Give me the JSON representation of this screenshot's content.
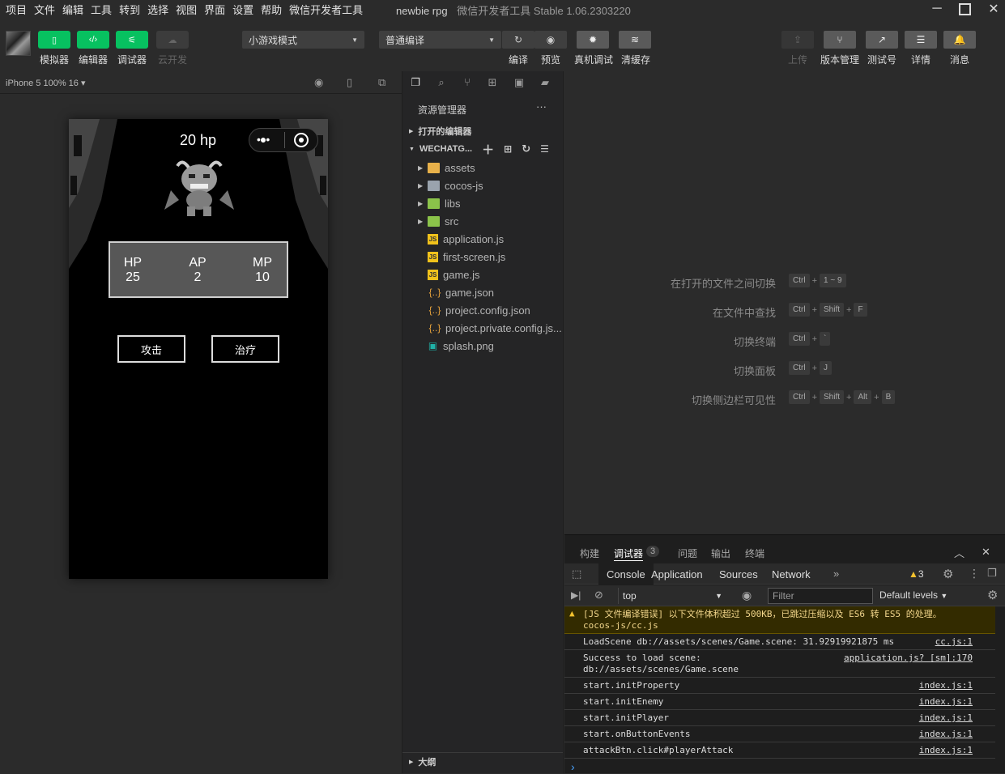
{
  "menu": [
    "项目",
    "文件",
    "编辑",
    "工具",
    "转到",
    "选择",
    "视图",
    "界面",
    "设置",
    "帮助",
    "微信开发者工具"
  ],
  "window_title": {
    "project": "newbie rpg",
    "app": "微信开发者工具 Stable 1.06.2303220"
  },
  "toolbar": {
    "left_buttons": [
      {
        "label": "模拟器",
        "icon": "phone-icon",
        "enabled": true
      },
      {
        "label": "编辑器",
        "icon": "code-icon",
        "enabled": true
      },
      {
        "label": "调试器",
        "icon": "sliders-icon",
        "enabled": true
      },
      {
        "label": "云开发",
        "icon": "cloud-icon",
        "enabled": false
      }
    ],
    "mode_select": "小游戏模式",
    "compile_select": "普通编译",
    "mid_buttons": [
      {
        "label": "编译",
        "icon": "refresh-icon"
      },
      {
        "label": "预览",
        "icon": "eye-icon"
      },
      {
        "label": "真机调试",
        "icon": "bug-icon"
      },
      {
        "label": "清缓存",
        "icon": "layers-icon"
      }
    ],
    "right_buttons": [
      {
        "label": "上传",
        "icon": "upload-icon",
        "enabled": false
      },
      {
        "label": "版本管理",
        "icon": "branch-icon",
        "enabled": true
      },
      {
        "label": "测试号",
        "icon": "external-icon",
        "enabled": true
      },
      {
        "label": "详情",
        "icon": "menu-icon",
        "enabled": true
      },
      {
        "label": "消息",
        "icon": "bell-icon",
        "enabled": true
      }
    ]
  },
  "simulator": {
    "device": "iPhone 5 100% 16",
    "game": {
      "enemy_hp": "20 hp",
      "stats": [
        {
          "label": "HP",
          "value": "25"
        },
        {
          "label": "AP",
          "value": "2"
        },
        {
          "label": "MP",
          "value": "10"
        }
      ],
      "attack_button": "攻击",
      "heal_button": "治疗"
    }
  },
  "explorer": {
    "title": "资源管理器",
    "more": "···",
    "open_editors": "打开的编辑器",
    "root": "WECHATG...",
    "items": [
      {
        "name": "assets",
        "type": "folder"
      },
      {
        "name": "cocos-js",
        "type": "folder"
      },
      {
        "name": "libs",
        "type": "folder"
      },
      {
        "name": "src",
        "type": "folder"
      },
      {
        "name": "application.js",
        "type": "js"
      },
      {
        "name": "first-screen.js",
        "type": "js"
      },
      {
        "name": "game.js",
        "type": "js"
      },
      {
        "name": "game.json",
        "type": "json"
      },
      {
        "name": "project.config.json",
        "type": "json"
      },
      {
        "name": "project.private.config.js...",
        "type": "json"
      },
      {
        "name": "splash.png",
        "type": "png"
      }
    ],
    "outline": "大纲"
  },
  "shortcuts": [
    {
      "label": "在打开的文件之间切换",
      "keys": [
        "Ctrl",
        "1 ~ 9"
      ]
    },
    {
      "label": "在文件中查找",
      "keys": [
        "Ctrl",
        "Shift",
        "F"
      ]
    },
    {
      "label": "切换终端",
      "keys": [
        "Ctrl",
        "`"
      ]
    },
    {
      "label": "切换面板",
      "keys": [
        "Ctrl",
        "J"
      ]
    },
    {
      "label": "切换侧边栏可见性",
      "keys": [
        "Ctrl",
        "Shift",
        "Alt",
        "B"
      ]
    }
  ],
  "panel": {
    "tabs": [
      "构建",
      "调试器",
      "问题",
      "输出",
      "终端"
    ],
    "debugger_badge": "3",
    "devtools_tabs": [
      "Console",
      "Application",
      "Sources",
      "Network"
    ],
    "warning_count": "3",
    "context": "top",
    "filter_placeholder": "Filter",
    "levels": "Default levels",
    "logs": [
      {
        "text": "[JS 文件编译错误] 以下文件体积超过 500KB，已跳过压缩以及 ES6 转 ES5 的处理。\ncocos-js/cc.js",
        "source": "",
        "warn": true
      },
      {
        "text": "LoadScene db://assets/scenes/Game.scene: 31.92919921875 ms",
        "source": "cc.js:1"
      },
      {
        "text": "Success to load scene:\ndb://assets/scenes/Game.scene",
        "source": "application.js? [sm]:170"
      },
      {
        "text": "start.initProperty",
        "source": "index.js:1"
      },
      {
        "text": "start.initEnemy",
        "source": "index.js:1"
      },
      {
        "text": "start.initPlayer",
        "source": "index.js:1"
      },
      {
        "text": "start.onButtonEvents",
        "source": "index.js:1"
      },
      {
        "text": "attackBtn.click#playerAttack",
        "source": "index.js:1"
      }
    ],
    "prompt": "›"
  }
}
